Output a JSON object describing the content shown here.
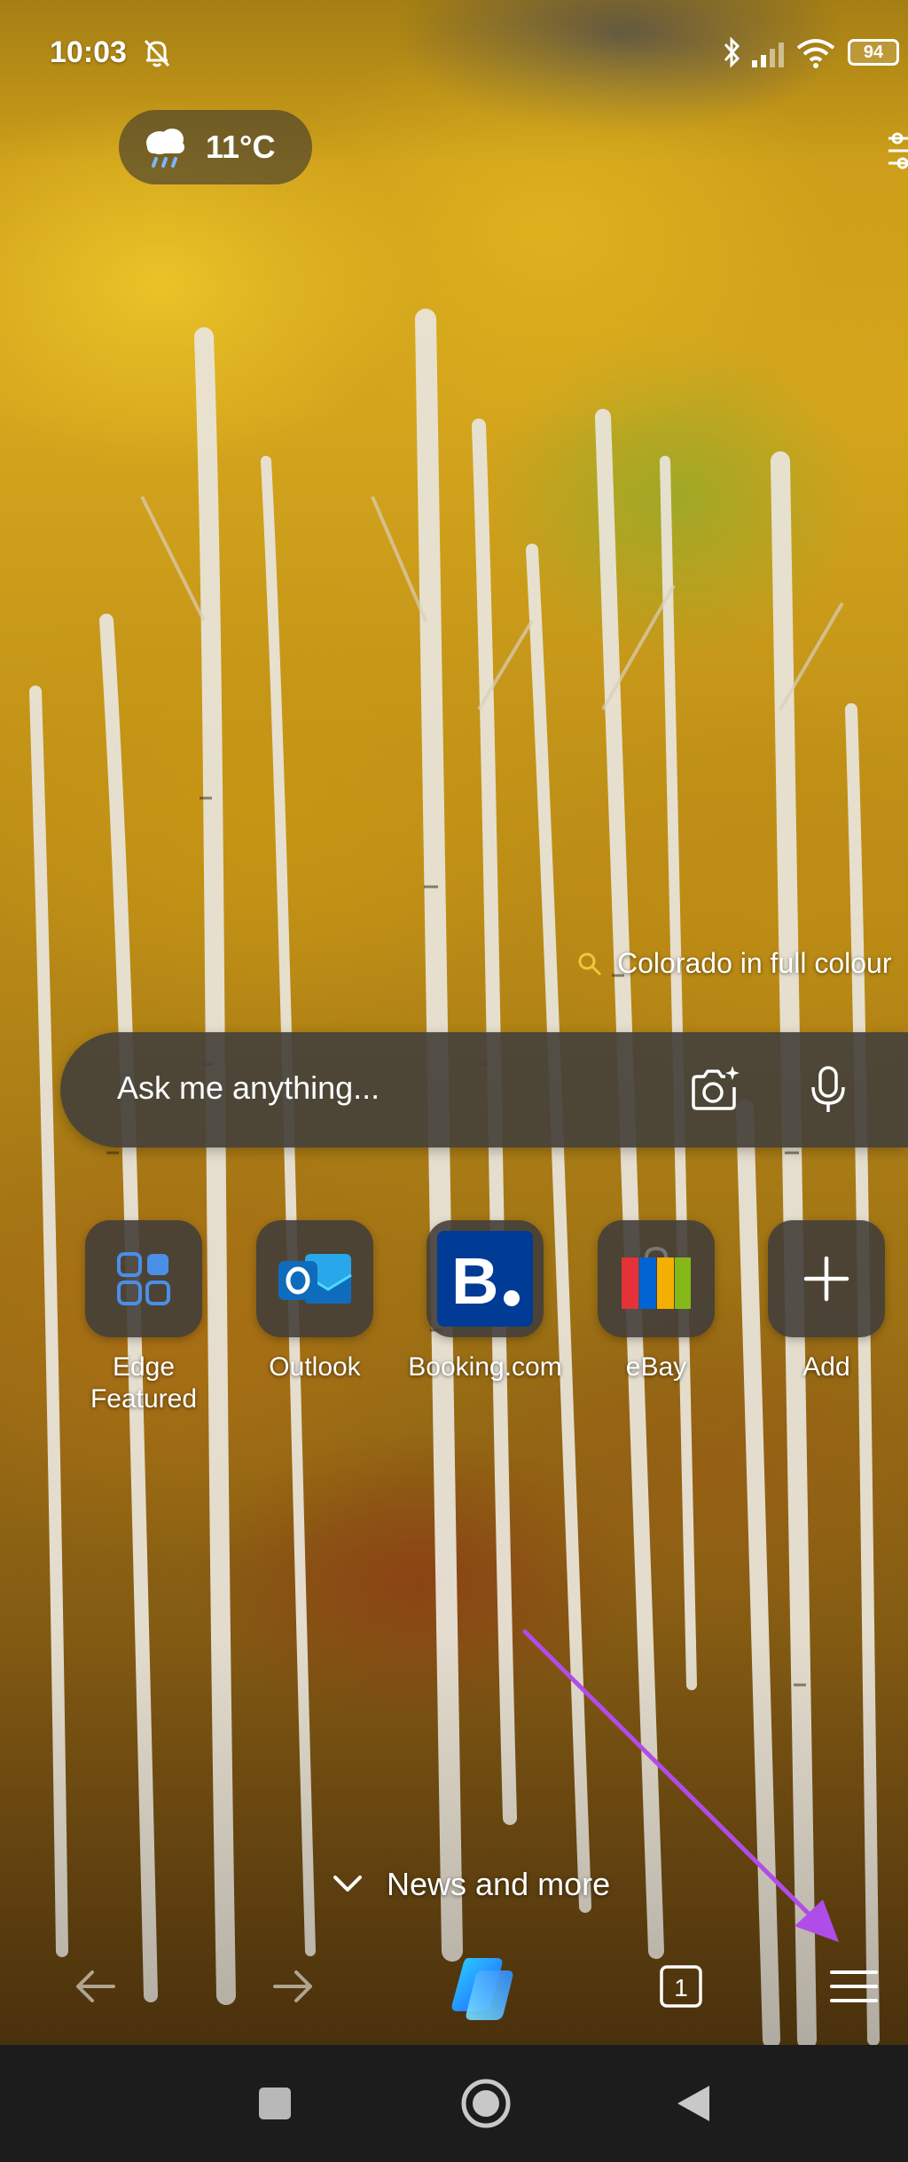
{
  "status_bar": {
    "time": "10:03",
    "battery": "94"
  },
  "weather": {
    "temperature": "11°C",
    "icon": "cloud-rain-icon"
  },
  "background_caption": {
    "text": "Colorado in full colour"
  },
  "search": {
    "placeholder": "Ask me anything..."
  },
  "top_sites": [
    {
      "label": "Edge Featured",
      "icon": "edge-featured-grid-icon"
    },
    {
      "label": "Outlook",
      "icon": "outlook-icon",
      "color": "#0F6CBD"
    },
    {
      "label": "Booking.com",
      "icon": "booking-icon",
      "color": "#003B95"
    },
    {
      "label": "eBay",
      "icon": "ebay-icon"
    },
    {
      "label": "Add",
      "icon": "plus-icon"
    }
  ],
  "news": {
    "label": "News and more"
  },
  "toolbar": {
    "tab_count": "1"
  },
  "colors": {
    "annotation_arrow": "#B04CE8",
    "accent_blue": "#4A8FE7"
  }
}
